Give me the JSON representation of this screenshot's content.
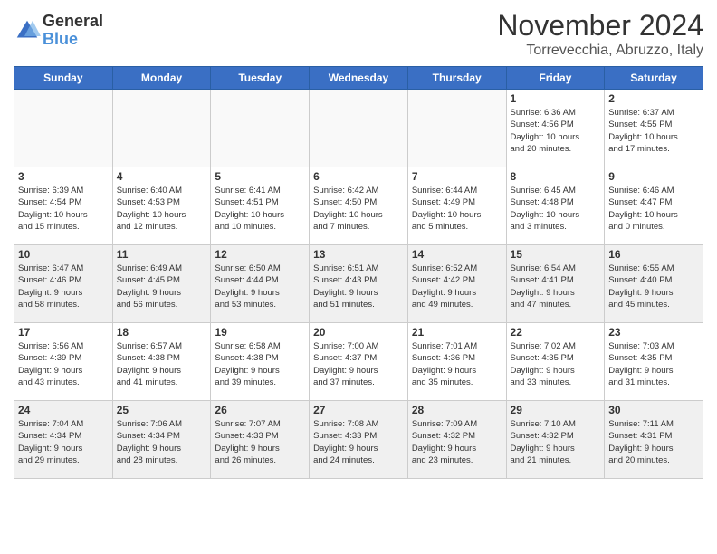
{
  "header": {
    "logo": {
      "general": "General",
      "blue": "Blue"
    },
    "title": "November 2024",
    "location": "Torrevecchia, Abruzzo, Italy"
  },
  "weekdays": [
    "Sunday",
    "Monday",
    "Tuesday",
    "Wednesday",
    "Thursday",
    "Friday",
    "Saturday"
  ],
  "weeks": [
    [
      {
        "day": "",
        "empty": true
      },
      {
        "day": "",
        "empty": true
      },
      {
        "day": "",
        "empty": true
      },
      {
        "day": "",
        "empty": true
      },
      {
        "day": "",
        "empty": true
      },
      {
        "day": "1",
        "info": "Sunrise: 6:36 AM\nSunset: 4:56 PM\nDaylight: 10 hours\nand 20 minutes."
      },
      {
        "day": "2",
        "info": "Sunrise: 6:37 AM\nSunset: 4:55 PM\nDaylight: 10 hours\nand 17 minutes."
      }
    ],
    [
      {
        "day": "3",
        "info": "Sunrise: 6:39 AM\nSunset: 4:54 PM\nDaylight: 10 hours\nand 15 minutes."
      },
      {
        "day": "4",
        "info": "Sunrise: 6:40 AM\nSunset: 4:53 PM\nDaylight: 10 hours\nand 12 minutes."
      },
      {
        "day": "5",
        "info": "Sunrise: 6:41 AM\nSunset: 4:51 PM\nDaylight: 10 hours\nand 10 minutes."
      },
      {
        "day": "6",
        "info": "Sunrise: 6:42 AM\nSunset: 4:50 PM\nDaylight: 10 hours\nand 7 minutes."
      },
      {
        "day": "7",
        "info": "Sunrise: 6:44 AM\nSunset: 4:49 PM\nDaylight: 10 hours\nand 5 minutes."
      },
      {
        "day": "8",
        "info": "Sunrise: 6:45 AM\nSunset: 4:48 PM\nDaylight: 10 hours\nand 3 minutes."
      },
      {
        "day": "9",
        "info": "Sunrise: 6:46 AM\nSunset: 4:47 PM\nDaylight: 10 hours\nand 0 minutes."
      }
    ],
    [
      {
        "day": "10",
        "shaded": true,
        "info": "Sunrise: 6:47 AM\nSunset: 4:46 PM\nDaylight: 9 hours\nand 58 minutes."
      },
      {
        "day": "11",
        "shaded": true,
        "info": "Sunrise: 6:49 AM\nSunset: 4:45 PM\nDaylight: 9 hours\nand 56 minutes."
      },
      {
        "day": "12",
        "shaded": true,
        "info": "Sunrise: 6:50 AM\nSunset: 4:44 PM\nDaylight: 9 hours\nand 53 minutes."
      },
      {
        "day": "13",
        "shaded": true,
        "info": "Sunrise: 6:51 AM\nSunset: 4:43 PM\nDaylight: 9 hours\nand 51 minutes."
      },
      {
        "day": "14",
        "shaded": true,
        "info": "Sunrise: 6:52 AM\nSunset: 4:42 PM\nDaylight: 9 hours\nand 49 minutes."
      },
      {
        "day": "15",
        "shaded": true,
        "info": "Sunrise: 6:54 AM\nSunset: 4:41 PM\nDaylight: 9 hours\nand 47 minutes."
      },
      {
        "day": "16",
        "shaded": true,
        "info": "Sunrise: 6:55 AM\nSunset: 4:40 PM\nDaylight: 9 hours\nand 45 minutes."
      }
    ],
    [
      {
        "day": "17",
        "info": "Sunrise: 6:56 AM\nSunset: 4:39 PM\nDaylight: 9 hours\nand 43 minutes."
      },
      {
        "day": "18",
        "info": "Sunrise: 6:57 AM\nSunset: 4:38 PM\nDaylight: 9 hours\nand 41 minutes."
      },
      {
        "day": "19",
        "info": "Sunrise: 6:58 AM\nSunset: 4:38 PM\nDaylight: 9 hours\nand 39 minutes."
      },
      {
        "day": "20",
        "info": "Sunrise: 7:00 AM\nSunset: 4:37 PM\nDaylight: 9 hours\nand 37 minutes."
      },
      {
        "day": "21",
        "info": "Sunrise: 7:01 AM\nSunset: 4:36 PM\nDaylight: 9 hours\nand 35 minutes."
      },
      {
        "day": "22",
        "info": "Sunrise: 7:02 AM\nSunset: 4:35 PM\nDaylight: 9 hours\nand 33 minutes."
      },
      {
        "day": "23",
        "info": "Sunrise: 7:03 AM\nSunset: 4:35 PM\nDaylight: 9 hours\nand 31 minutes."
      }
    ],
    [
      {
        "day": "24",
        "shaded": true,
        "info": "Sunrise: 7:04 AM\nSunset: 4:34 PM\nDaylight: 9 hours\nand 29 minutes."
      },
      {
        "day": "25",
        "shaded": true,
        "info": "Sunrise: 7:06 AM\nSunset: 4:34 PM\nDaylight: 9 hours\nand 28 minutes."
      },
      {
        "day": "26",
        "shaded": true,
        "info": "Sunrise: 7:07 AM\nSunset: 4:33 PM\nDaylight: 9 hours\nand 26 minutes."
      },
      {
        "day": "27",
        "shaded": true,
        "info": "Sunrise: 7:08 AM\nSunset: 4:33 PM\nDaylight: 9 hours\nand 24 minutes."
      },
      {
        "day": "28",
        "shaded": true,
        "info": "Sunrise: 7:09 AM\nSunset: 4:32 PM\nDaylight: 9 hours\nand 23 minutes."
      },
      {
        "day": "29",
        "shaded": true,
        "info": "Sunrise: 7:10 AM\nSunset: 4:32 PM\nDaylight: 9 hours\nand 21 minutes."
      },
      {
        "day": "30",
        "shaded": true,
        "info": "Sunrise: 7:11 AM\nSunset: 4:31 PM\nDaylight: 9 hours\nand 20 minutes."
      }
    ]
  ]
}
